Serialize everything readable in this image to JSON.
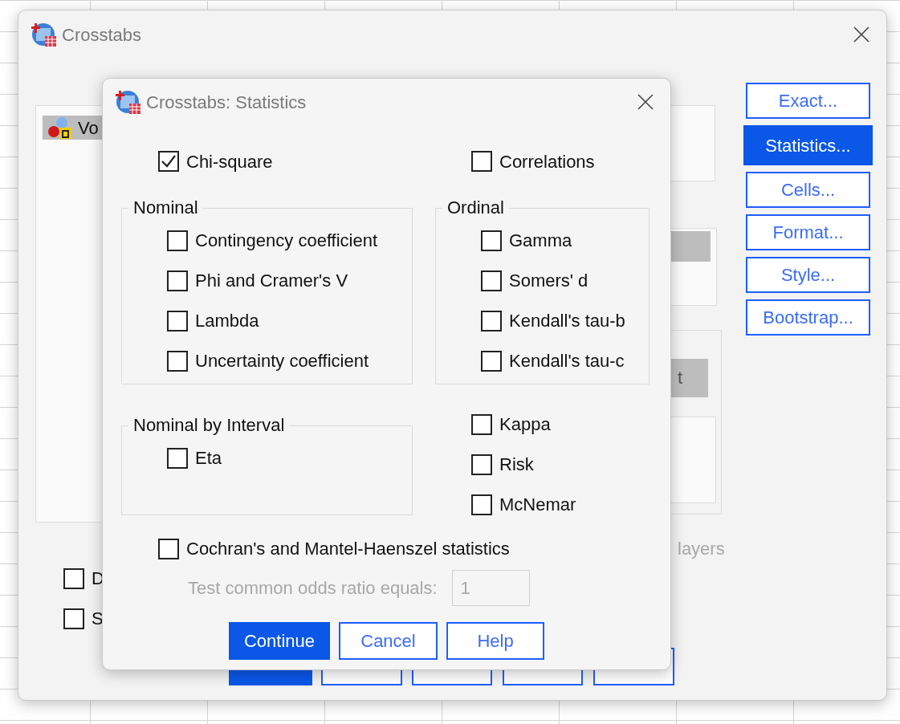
{
  "main_window": {
    "title": "Crosstabs",
    "list_items": [
      {
        "label": "Vo",
        "selected": true
      }
    ],
    "next_button_fragment": "t",
    "layers_label": "layers",
    "side_buttons": [
      {
        "label": "Exact...",
        "selected": false
      },
      {
        "label": "Statistics...",
        "selected": true
      },
      {
        "label": "Cells...",
        "selected": false
      },
      {
        "label": "Format...",
        "selected": false
      },
      {
        "label": "Style...",
        "selected": false
      },
      {
        "label": "Bootstrap...",
        "selected": false
      }
    ],
    "checkboxes": [
      {
        "label": "D",
        "checked": false
      },
      {
        "label": "S",
        "checked": false
      }
    ],
    "bottom_buttons": [
      {
        "kind": "primary"
      },
      {
        "kind": "default"
      },
      {
        "kind": "default"
      },
      {
        "kind": "default"
      },
      {
        "kind": "default"
      }
    ]
  },
  "dialog": {
    "title": "Crosstabs: Statistics",
    "top_options": [
      {
        "label": "Chi-square",
        "checked": true
      },
      {
        "label": "Correlations",
        "checked": false
      }
    ],
    "groups": [
      {
        "title": "Nominal",
        "options": [
          {
            "label": "Contingency coefficient",
            "checked": false
          },
          {
            "label": "Phi and Cramer's V",
            "checked": false
          },
          {
            "label": "Lambda",
            "checked": false
          },
          {
            "label": "Uncertainty coefficient",
            "checked": false
          }
        ]
      },
      {
        "title": "Ordinal",
        "options": [
          {
            "label": "Gamma",
            "checked": false
          },
          {
            "label": "Somers' d",
            "checked": false
          },
          {
            "label": "Kendall's tau-b",
            "checked": false
          },
          {
            "label": "Kendall's tau-c",
            "checked": false
          }
        ]
      },
      {
        "title": "Nominal by Interval",
        "options": [
          {
            "label": "Eta",
            "checked": false
          }
        ]
      }
    ],
    "extra_options": [
      {
        "label": "Kappa",
        "checked": false
      },
      {
        "label": "Risk",
        "checked": false
      },
      {
        "label": "McNemar",
        "checked": false
      }
    ],
    "cmh": {
      "label": "Cochran's and Mantel-Haenszel statistics",
      "checked": false
    },
    "odds_ratio": {
      "label": "Test common odds ratio equals:",
      "value": "1",
      "disabled": true
    },
    "buttons": [
      {
        "label": "Continue",
        "kind": "primary"
      },
      {
        "label": "Cancel",
        "kind": "default"
      },
      {
        "label": "Help",
        "kind": "default"
      }
    ]
  }
}
